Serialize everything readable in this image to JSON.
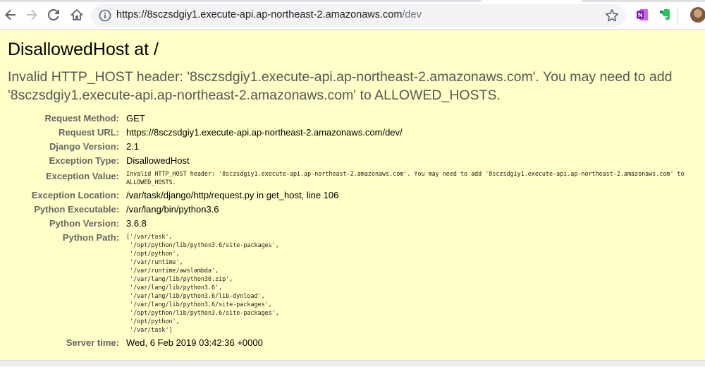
{
  "browser": {
    "url_host": "https://8sczsdgiy1.execute-api.ap-northeast-2.amazonaws.com",
    "url_path": "/dev"
  },
  "error": {
    "title": "DisallowedHost at /",
    "message": "Invalid HTTP_HOST header: '8sczsdgiy1.execute-api.ap-northeast-2.amazonaws.com'. You may need to add '8sczsdgiy1.execute-api.ap-northeast-2.amazonaws.com' to ALLOWED_HOSTS."
  },
  "meta": {
    "request_method": {
      "label": "Request Method:",
      "value": "GET"
    },
    "request_url": {
      "label": "Request URL:",
      "value": "https://8sczsdgiy1.execute-api.ap-northeast-2.amazonaws.com/dev/"
    },
    "django_version": {
      "label": "Django Version:",
      "value": "2.1"
    },
    "exception_type": {
      "label": "Exception Type:",
      "value": "DisallowedHost"
    },
    "exception_value": {
      "label": "Exception Value:",
      "value": "Invalid HTTP_HOST header: '8sczsdgiy1.execute-api.ap-northeast-2.amazonaws.com'. You may need to add '8sczsdgiy1.execute-api.ap-northeast-2.amazonaws.com' to ALLOWED_HOSTS."
    },
    "exception_location": {
      "label": "Exception Location:",
      "value": "/var/task/django/http/request.py in get_host, line 106"
    },
    "python_executable": {
      "label": "Python Executable:",
      "value": "/var/lang/bin/python3.6"
    },
    "python_version": {
      "label": "Python Version:",
      "value": "3.6.8"
    },
    "python_path": {
      "label": "Python Path:",
      "lines": [
        "['/var/task',",
        " '/opt/python/lib/python3.6/site-packages',",
        " '/opt/python',",
        " '/var/runtime',",
        " '/var/runtime/awslambda',",
        " '/var/lang/lib/python36.zip',",
        " '/var/lang/lib/python3.6',",
        " '/var/lang/lib/python3.6/lib-dynload',",
        " '/var/lang/lib/python3.6/site-packages',",
        " '/opt/python/lib/python3.6/site-packages',",
        " '/opt/python',",
        " '/var/task']"
      ]
    },
    "server_time": {
      "label": "Server time:",
      "value": "Wed, 6 Feb 2019 03:42:36 +0000"
    }
  }
}
